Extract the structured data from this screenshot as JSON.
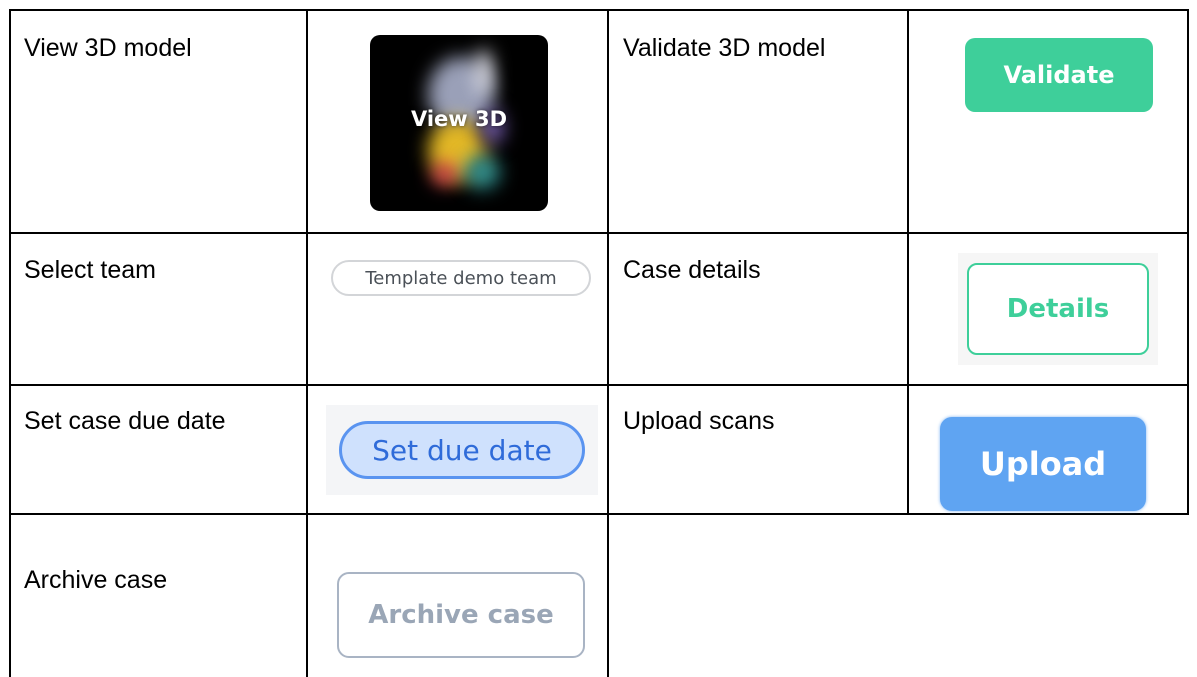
{
  "rows": [
    {
      "left_label": "View 3D model",
      "left_button": "View 3D",
      "right_label": "Validate 3D model",
      "right_button": "Validate"
    },
    {
      "left_label": "Select team",
      "left_button": "Template demo team",
      "right_label": "Case details",
      "right_button": "Details"
    },
    {
      "left_label": "Set case due date",
      "left_button": "Set due date",
      "right_label": "Upload scans",
      "right_button": "Upload"
    },
    {
      "left_label": "Archive case",
      "left_button": "Archive case"
    }
  ],
  "colors": {
    "green": "#3ecf9a",
    "blue": "#5fa4f2",
    "blue_text": "#2f6bd9",
    "blue_fill": "#cfe1fd",
    "gray_border": "#a9b4c4",
    "gray_text": "#9aa6b6",
    "pill_border": "#d3d5d8"
  }
}
